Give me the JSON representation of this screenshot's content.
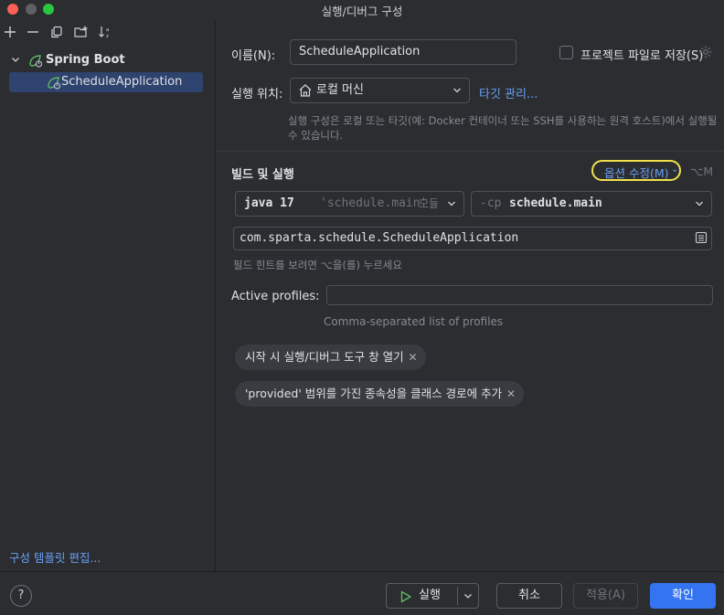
{
  "window": {
    "title": "실행/디버그 구성"
  },
  "sidebar": {
    "tree": [
      {
        "label": "Spring Boot",
        "expanded": true
      },
      {
        "label": "ScheduleApplication",
        "selected": true
      }
    ],
    "edit_templates_link": "구성 템플릿 편집..."
  },
  "form": {
    "name_label": "이름(N):",
    "name_value": "ScheduleApplication",
    "store_as_project_file_label": "프로젝트 파일로 저장(S)",
    "run_on_label": "실행 위치:",
    "run_on_value": "로컬 머신",
    "manage_targets_link": "타깃 관리...",
    "run_on_hint": "실행 구성은 로컬 또는 타깃(예: Docker 컨테이너 또는 SSH를 사용하는 원격 호스트)에서 실행될 수 있습니다.",
    "build_run_title": "빌드 및 실행",
    "modify_options_link": "옵션 수정(M)",
    "modify_options_shortcut": "⌥M",
    "jdk_select": {
      "version": "java 17",
      "module": "'schedule.main'",
      "suffix": "모듈"
    },
    "classpath_select": {
      "flag": "-cp",
      "value": "schedule.main"
    },
    "main_class_value": "com.sparta.schedule.ScheduleApplication",
    "build_hint": "필드 힌트를 보려면 ⌥을(를) 누르세요",
    "active_profiles_label": "Active profiles:",
    "active_profiles_value": "",
    "active_profiles_hint": "Comma-separated list of profiles",
    "chips": [
      "시작 시 실행/디버그 도구 창 열기",
      "'provided' 범위를 가진 종속성을 클래스 경로에 추가"
    ]
  },
  "footer": {
    "help": "?",
    "run_button": "실행",
    "cancel_button": "취소",
    "apply_button": "적용(A)",
    "ok_button": "확인"
  },
  "colors": {
    "accent": "#3574f0",
    "link": "#6a9ff6",
    "selection": "#2e436e",
    "highlight_annotation": "#f0e14a",
    "run_green": "#5fb865"
  },
  "icons": {
    "toolbar": [
      "add-icon",
      "remove-icon",
      "copy-icon",
      "new-folder-icon",
      "sort-icon"
    ],
    "spring_boot": "spring-boot-icon",
    "gear": "gear-icon",
    "home": "home-icon",
    "run": "run-triangle-icon",
    "browse": "browse-icon"
  }
}
